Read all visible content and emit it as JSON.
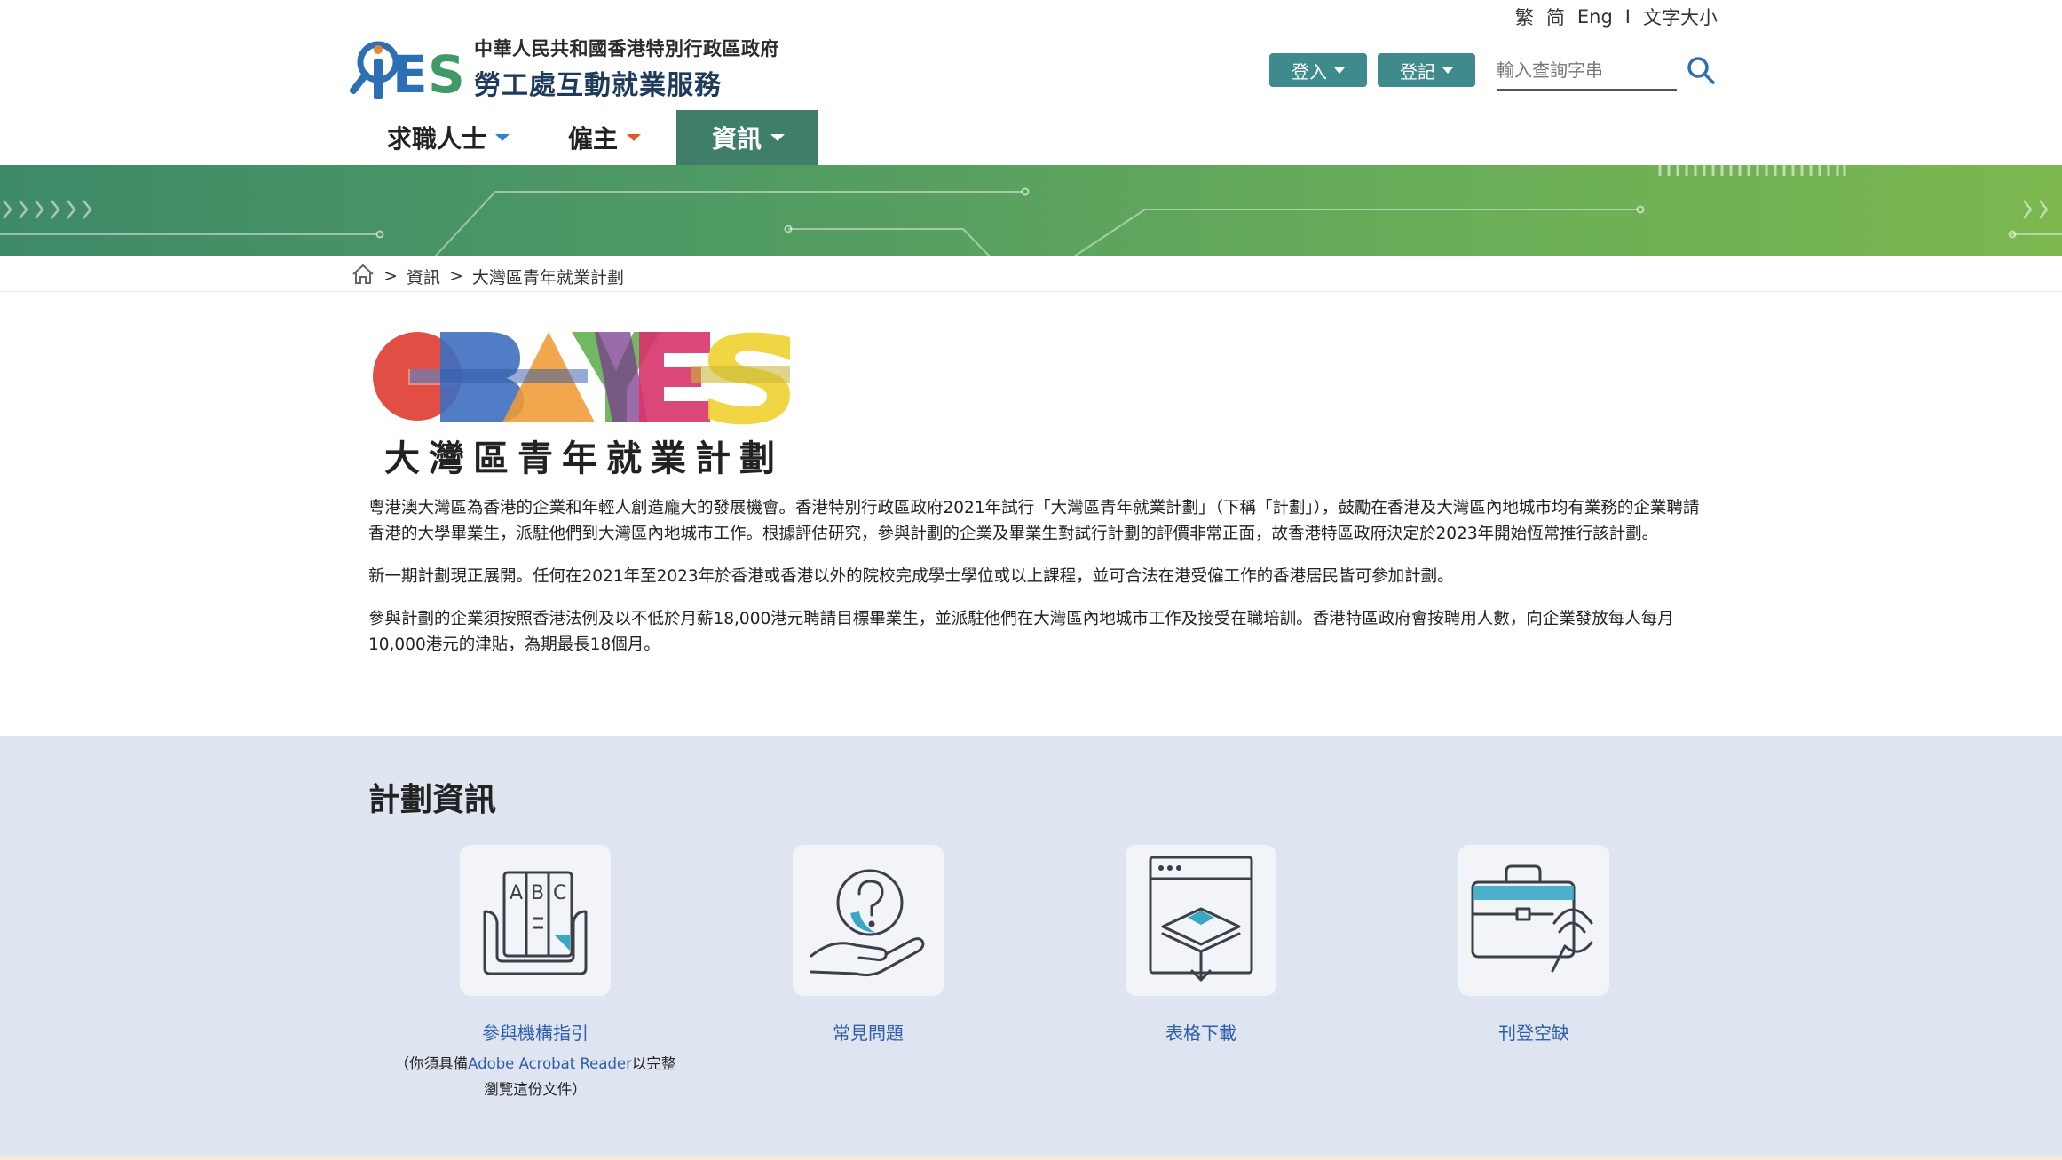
{
  "header": {
    "logo_text_line1": "中華人民共和國香港特別行政區政府",
    "logo_text_line2": "勞工處互動就業服務",
    "logo_mark": "iES",
    "lang_options": [
      "繁",
      "简",
      "Eng"
    ],
    "lang_separator": "I",
    "font_size_label": "文字大小",
    "login_label": "登入",
    "register_label": "登記",
    "search_placeholder": "輸入查詢字串"
  },
  "nav": {
    "items": [
      {
        "label": "求職人士",
        "caret_color": "#2f7fd0"
      },
      {
        "label": "僱主",
        "caret_color": "#e0582a"
      },
      {
        "label": "資訊",
        "caret_color": "#ffffff"
      }
    ],
    "active_index": 2
  },
  "breadcrumb": {
    "separator": ">",
    "items": [
      "資訊",
      "大灣區青年就業計劃"
    ]
  },
  "scheme_logo": {
    "wordmark": "GBAYES",
    "caption": "大灣區青年就業計劃"
  },
  "intro": {
    "paragraphs": [
      "粵港澳大灣區為香港的企業和年輕人創造龐大的發展機會。香港特別行政區政府2021年試行「大灣區青年就業計劃」（下稱「計劃」），鼓勵在香港及大灣區內地城市均有業務的企業聘請香港的大學畢業生，派駐他們到大灣區內地城市工作。根據評估研究，參與計劃的企業及畢業生對試行計劃的評價非常正面，故香港特區政府決定於2023年開始恆常推行該計劃。",
      "新一期計劃現正展開。任何在2021年至2023年於香港或香港以外的院校完成學士學位或以上課程，並可合法在港受僱工作的香港居民皆可參加計劃。",
      "參與計劃的企業須按照香港法例及以不低於月薪18,000港元聘請目標畢業生，並派駐他們在大灣區內地城市工作及接受在職培訓。香港特區政府會按聘用人數，向企業發放每人每月10,000港元的津貼，為期最長18個月。"
    ]
  },
  "info_section": {
    "title": "計劃資訊",
    "cards": [
      {
        "label": "參與機構指引",
        "icon": "guide-book-icon"
      },
      {
        "label": "常見問題",
        "icon": "faq-hand-question-icon"
      },
      {
        "label": "表格下載",
        "icon": "form-download-icon"
      },
      {
        "label": "刊登空缺",
        "icon": "briefcase-post-vacancy-icon"
      }
    ],
    "note_prefix": "（你須具備",
    "note_link": "Adobe Acrobat Reader",
    "note_suffix": "以完整瀏覽這份文件）"
  },
  "colors": {
    "header_button": "#3f8a8c",
    "nav_active": "#3f7f6a",
    "banner_start": "#3f8a68",
    "banner_end": "#7cb84f",
    "link": "#2f5fa8",
    "info_bg": "#dfe5f0"
  }
}
